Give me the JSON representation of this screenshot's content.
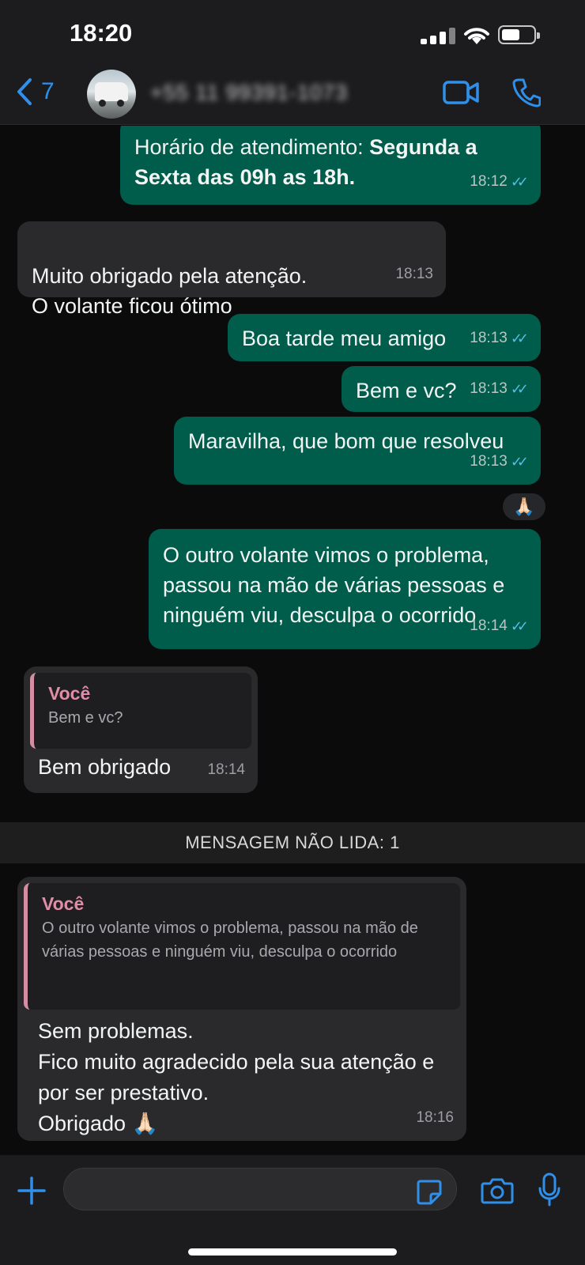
{
  "status_bar": {
    "time": "18:20"
  },
  "header": {
    "back_count": "7",
    "contact_name": "+55 11 99391-1073"
  },
  "messages": [
    {
      "dir": "out",
      "text_plain": "Horário de atendimento: ",
      "text_bold": "Segunda a Sexta das 09h as 18h.",
      "time": "18:12"
    },
    {
      "dir": "in",
      "text": "Muito obrigado pela atenção.\nO volante ficou ótimo",
      "time": "18:13"
    },
    {
      "dir": "out",
      "text": "Boa tarde meu amigo",
      "time": "18:13"
    },
    {
      "dir": "out",
      "text": "Bem e vc?",
      "time": "18:13"
    },
    {
      "dir": "out",
      "text": "Maravilha, que bom que resolveu",
      "time": "18:13",
      "reaction": "🙏🏻"
    },
    {
      "dir": "out",
      "text": "O outro volante vimos o problema, passou na mão de várias pessoas e ninguém viu, desculpa o ocorrido",
      "time": "18:14"
    },
    {
      "dir": "in",
      "quote_name": "Você",
      "quote_text": "Bem e vc?",
      "text": "Bem obrigado",
      "time": "18:14"
    },
    {
      "dir": "in",
      "quote_name": "Você",
      "quote_text": "O outro volante vimos o problema, passou na mão de várias pessoas e ninguém viu, desculpa o ocorrido",
      "text": "Sem problemas.\nFico muito agradecido pela sua atenção e por ser prestativo.\nObrigado 🙏🏻",
      "time": "18:16"
    }
  ],
  "unread_banner": "MENSAGEM NÃO LIDA: 1",
  "composer": {
    "placeholder": ""
  },
  "colors": {
    "accent": "#2f8fe9",
    "outgoing": "#005c4b",
    "incoming": "#2a2a2c",
    "read_tick": "#53bdeb",
    "quote_name": "#e08ea7"
  },
  "icons": [
    "back-chevron-icon",
    "video-call-icon",
    "phone-icon",
    "double-check-icon",
    "plus-icon",
    "sticker-icon",
    "camera-icon",
    "microphone-icon"
  ]
}
